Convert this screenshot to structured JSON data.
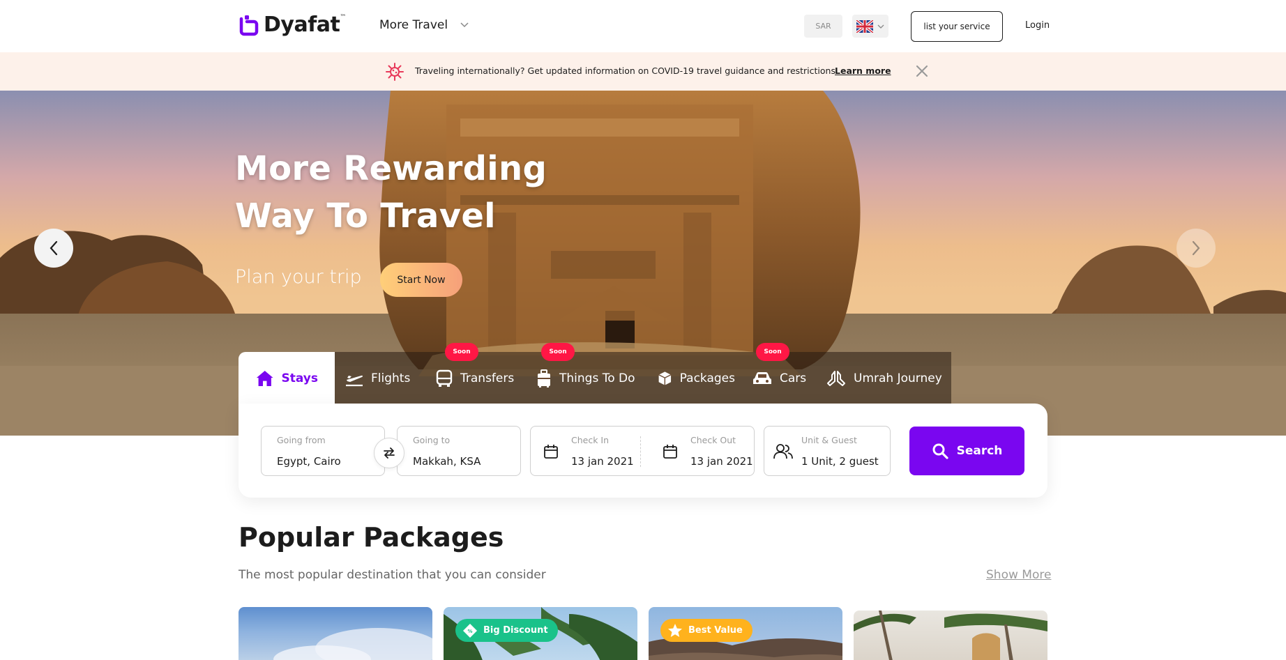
{
  "header": {
    "logo_text": "Dyafat",
    "logo_tm": "™",
    "more_travel": "More Travel",
    "currency": "SAR",
    "list_service": "list your service",
    "login": "Login"
  },
  "banner": {
    "text": "Traveling internationally? Get updated information on COVID-19 travel guidance and restrictions.",
    "link": "Learn more"
  },
  "hero": {
    "title_line1": "More Rewarding",
    "title_line2": "Way To Travel",
    "subtitle": "Plan your trip",
    "cta": "Start Now"
  },
  "tabs": [
    {
      "label": "Stays",
      "icon": "home-icon",
      "active": true,
      "badge": ""
    },
    {
      "label": "Flights",
      "icon": "plane-icon",
      "active": false,
      "badge": ""
    },
    {
      "label": "Transfers",
      "icon": "bus-icon",
      "active": false,
      "badge": "Soon"
    },
    {
      "label": "Things To Do",
      "icon": "luggage-icon",
      "active": false,
      "badge": "Soon"
    },
    {
      "label": "Packages",
      "icon": "box-icon",
      "active": false,
      "badge": ""
    },
    {
      "label": "Cars",
      "icon": "car-icon",
      "active": false,
      "badge": "Soon"
    },
    {
      "label": "Umrah Journey",
      "icon": "praying-hands-icon",
      "active": false,
      "badge": ""
    }
  ],
  "search": {
    "going_from_label": "Going from",
    "going_from_value": "Egypt, Cairo",
    "going_to_label": "Going to",
    "going_to_value": "Makkah, KSA",
    "check_in_label": "Check In",
    "check_in_value": "13 jan 2021",
    "check_out_label": "Check Out",
    "check_out_value": "13 jan 2021",
    "guests_label": "Unit & Guest",
    "guests_value": "1 Unit, 2 guest",
    "button": "Search"
  },
  "popular": {
    "title": "Popular Packages",
    "subtitle": "The most popular destination that you can consider",
    "show_more": "Show More",
    "badges": [
      "Big Discount",
      "Best Value"
    ]
  },
  "colors": {
    "brand": "#7a06f0",
    "soon_badge": "#ff1745",
    "banner_bg": "#fdf1ea",
    "discount_badge": "#1ac28a",
    "value_badge": "#ffb21d"
  }
}
